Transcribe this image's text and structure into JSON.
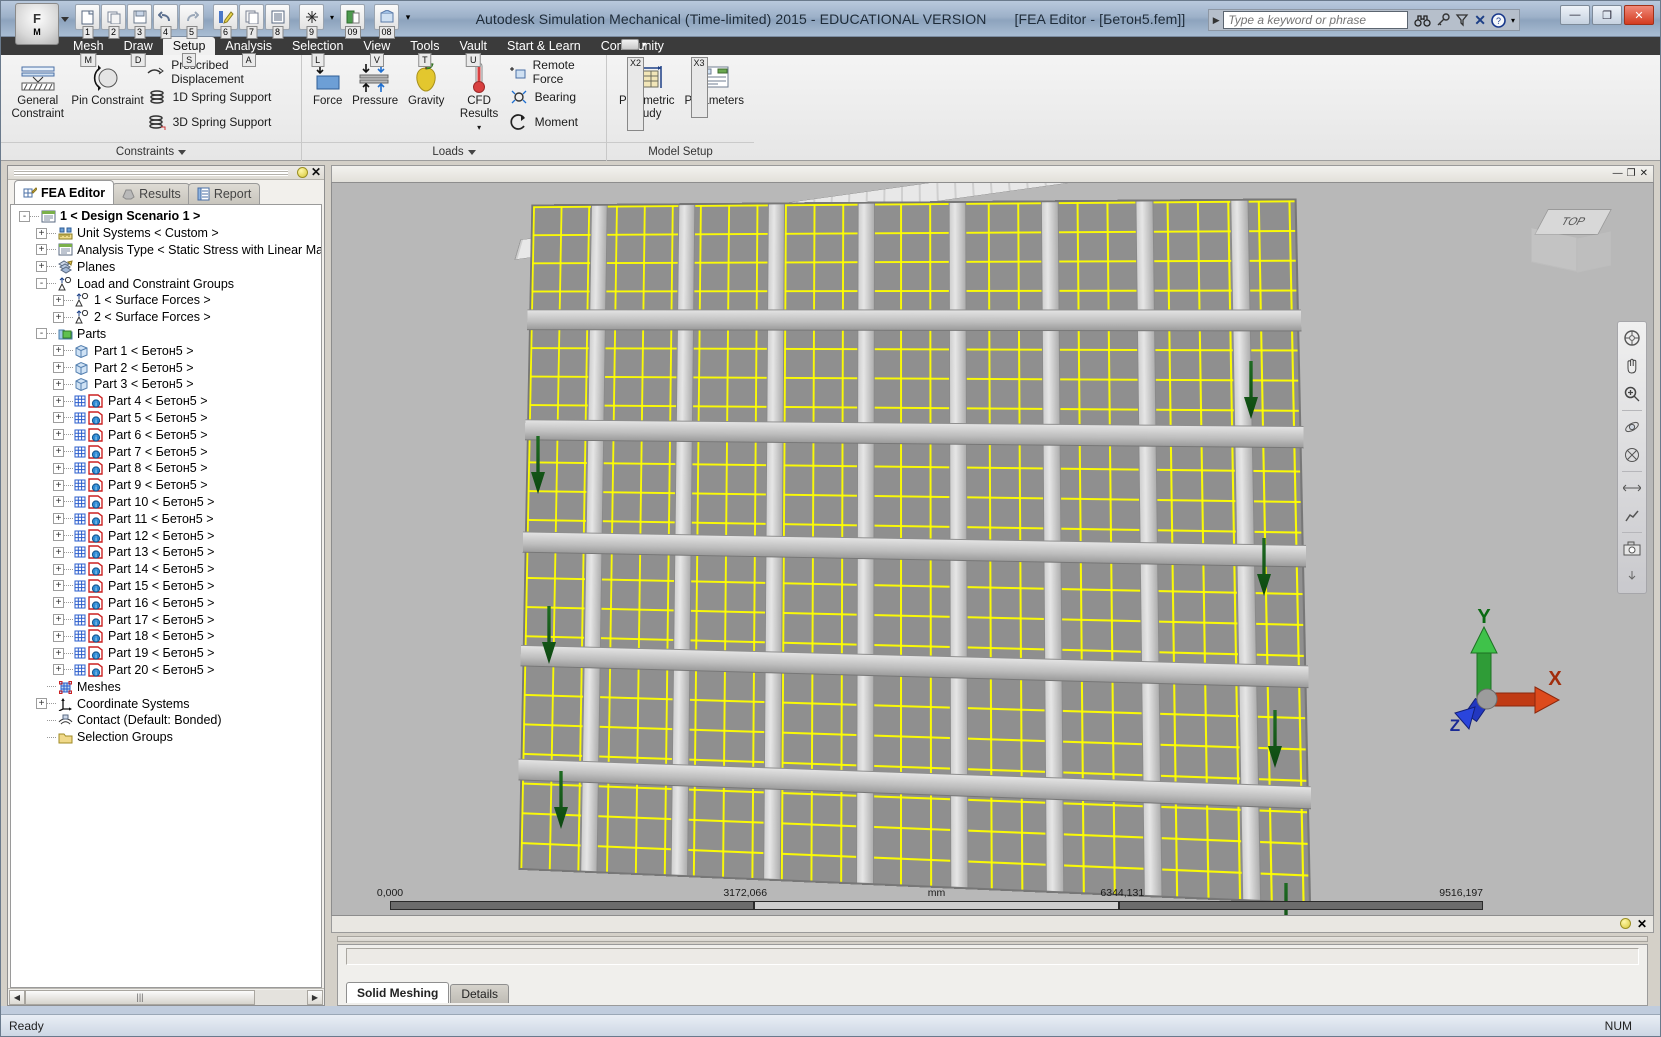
{
  "window": {
    "title": "Autodesk Simulation Mechanical (Time-limited) 2015 - EDUCATIONAL VERSION",
    "document": "[FEA Editor - [Бетон5.fem]]",
    "minimize_label": "—",
    "restore_label": "❐",
    "close_label": "✕",
    "app_button_label": "F",
    "app_button_key": "M"
  },
  "quick_access": {
    "items": [
      {
        "name": "new-document",
        "key": "1"
      },
      {
        "name": "open-document",
        "key": "2"
      },
      {
        "name": "save-document",
        "key": "3"
      },
      {
        "name": "undo",
        "key": "4"
      },
      {
        "name": "redo",
        "key": "5"
      },
      {
        "name": "edit-color",
        "key": "6"
      },
      {
        "name": "copy",
        "key": "7"
      },
      {
        "name": "report",
        "key": "8"
      },
      {
        "name": "mesh-settings",
        "key": "9"
      },
      {
        "name": "results-options",
        "key": "09"
      },
      {
        "name": "model-view",
        "key": "08"
      }
    ]
  },
  "search": {
    "placeholder": "Type a keyword or phrase",
    "icons": [
      "binoculars-icon",
      "key-icon",
      "funnel-icon",
      "exchange-icon",
      "help-icon"
    ]
  },
  "ribbon": {
    "tabs": [
      {
        "label": "Mesh",
        "key": "M",
        "active": false
      },
      {
        "label": "Draw",
        "key": "D",
        "active": false
      },
      {
        "label": "Setup",
        "key": "S",
        "active": true
      },
      {
        "label": "Analysis",
        "key": "A",
        "active": false
      },
      {
        "label": "Selection",
        "key": "L",
        "active": false
      },
      {
        "label": "View",
        "key": "V",
        "active": false
      },
      {
        "label": "Tools",
        "key": "T",
        "active": false
      },
      {
        "label": "Vault",
        "key": "U",
        "active": false
      },
      {
        "label": "Start & Learn",
        "key": "",
        "active": false
      },
      {
        "label": "Community",
        "key": "",
        "active": false
      }
    ],
    "groups": [
      {
        "title": "Constraints",
        "big_buttons": [
          {
            "label": "General Constraint",
            "icon": "general-constraint-icon"
          },
          {
            "label": "Pin Constraint",
            "icon": "pin-constraint-icon"
          }
        ],
        "small_items": [
          {
            "label": "Prescribed Displacement",
            "icon": "prescribed-displacement-icon"
          },
          {
            "label": "1D Spring Support",
            "icon": "spring-1d-icon"
          },
          {
            "label": "3D Spring Support",
            "icon": "spring-3d-icon"
          }
        ]
      },
      {
        "title": "Loads",
        "big_buttons": [
          {
            "label": "Force",
            "icon": "force-icon"
          },
          {
            "label": "Pressure",
            "icon": "pressure-icon"
          },
          {
            "label": "Gravity",
            "icon": "gravity-apple-icon"
          },
          {
            "label": "CFD Results",
            "icon": "cfd-thermometer-icon"
          }
        ],
        "small_items": [
          {
            "label": "Remote Force",
            "icon": "remote-force-icon"
          },
          {
            "label": "Bearing",
            "icon": "bearing-icon"
          },
          {
            "label": "Moment",
            "icon": "moment-icon"
          }
        ]
      },
      {
        "title": "Model Setup",
        "big_buttons": [
          {
            "label": "Parametric Study",
            "icon": "parametric-study-icon",
            "key": "X2"
          },
          {
            "label": "Parameters",
            "icon": "parameters-icon",
            "key": "X3"
          }
        ],
        "small_items": []
      }
    ]
  },
  "tree_panel": {
    "tabs": [
      {
        "label": "FEA Editor",
        "icon": "fea-editor-icon",
        "active": true
      },
      {
        "label": "Results",
        "icon": "results-icon",
        "active": false
      },
      {
        "label": "Report",
        "icon": "report-icon",
        "active": false
      }
    ],
    "items": [
      {
        "label": "1 < Design Scenario 1 >",
        "depth": 0,
        "expander": "-",
        "icon": "scenario-icon",
        "bold": true
      },
      {
        "label": "Unit Systems < Custom >",
        "depth": 1,
        "expander": "+",
        "icon": "unit-systems-icon",
        "bold": false
      },
      {
        "label": "Analysis Type < Static Stress with Linear Mater",
        "depth": 1,
        "expander": "+",
        "icon": "analysis-type-icon",
        "bold": false
      },
      {
        "label": "Planes",
        "depth": 1,
        "expander": "+",
        "icon": "planes-icon",
        "bold": false
      },
      {
        "label": "Load and Constraint Groups",
        "depth": 1,
        "expander": "-",
        "icon": "load-constraint-icon",
        "bold": false
      },
      {
        "label": "1 < Surface Forces >",
        "depth": 2,
        "expander": "+",
        "icon": "surface-forces-icon",
        "bold": false
      },
      {
        "label": "2 < Surface Forces >",
        "depth": 2,
        "expander": "+",
        "icon": "surface-forces-icon",
        "bold": false
      },
      {
        "label": "Parts",
        "depth": 1,
        "expander": "-",
        "icon": "parts-folder-icon",
        "bold": false
      },
      {
        "label": "Part 1 < Бетон5 >",
        "depth": 2,
        "expander": "+",
        "icon": "part-solid-icon",
        "bold": false
      },
      {
        "label": "Part 2 < Бетон5 >",
        "depth": 2,
        "expander": "+",
        "icon": "part-solid-icon",
        "bold": false
      },
      {
        "label": "Part 3 < Бетон5 >",
        "depth": 2,
        "expander": "+",
        "icon": "part-solid-icon",
        "bold": false
      },
      {
        "label": "Part 4 < Бетон5 >",
        "depth": 2,
        "expander": "+",
        "icon": "part-meshed-icon",
        "bold": false
      },
      {
        "label": "Part 5 < Бетон5 >",
        "depth": 2,
        "expander": "+",
        "icon": "part-meshed-icon",
        "bold": false
      },
      {
        "label": "Part 6 < Бетон5 >",
        "depth": 2,
        "expander": "+",
        "icon": "part-meshed-icon",
        "bold": false
      },
      {
        "label": "Part 7 < Бетон5 >",
        "depth": 2,
        "expander": "+",
        "icon": "part-meshed-icon",
        "bold": false
      },
      {
        "label": "Part 8 < Бетон5 >",
        "depth": 2,
        "expander": "+",
        "icon": "part-meshed-icon",
        "bold": false
      },
      {
        "label": "Part 9 < Бетон5 >",
        "depth": 2,
        "expander": "+",
        "icon": "part-meshed-icon",
        "bold": false
      },
      {
        "label": "Part 10 < Бетон5 >",
        "depth": 2,
        "expander": "+",
        "icon": "part-meshed-icon",
        "bold": false
      },
      {
        "label": "Part 11 < Бетон5 >",
        "depth": 2,
        "expander": "+",
        "icon": "part-meshed-icon",
        "bold": false
      },
      {
        "label": "Part 12 < Бетон5 >",
        "depth": 2,
        "expander": "+",
        "icon": "part-meshed-icon",
        "bold": false
      },
      {
        "label": "Part 13 < Бетон5 >",
        "depth": 2,
        "expander": "+",
        "icon": "part-meshed-icon",
        "bold": false
      },
      {
        "label": "Part 14 < Бетон5 >",
        "depth": 2,
        "expander": "+",
        "icon": "part-meshed-icon",
        "bold": false
      },
      {
        "label": "Part 15 < Бетон5 >",
        "depth": 2,
        "expander": "+",
        "icon": "part-meshed-icon",
        "bold": false
      },
      {
        "label": "Part 16 < Бетон5 >",
        "depth": 2,
        "expander": "+",
        "icon": "part-meshed-icon",
        "bold": false
      },
      {
        "label": "Part 17 < Бетон5 >",
        "depth": 2,
        "expander": "+",
        "icon": "part-meshed-icon",
        "bold": false
      },
      {
        "label": "Part 18 < Бетон5 >",
        "depth": 2,
        "expander": "+",
        "icon": "part-meshed-icon",
        "bold": false
      },
      {
        "label": "Part 19 < Бетон5 >",
        "depth": 2,
        "expander": "+",
        "icon": "part-meshed-icon",
        "bold": false
      },
      {
        "label": "Part 20 < Бетон5 >",
        "depth": 2,
        "expander": "+",
        "icon": "part-meshed-icon",
        "bold": false
      },
      {
        "label": "Meshes",
        "depth": 1,
        "expander": "",
        "icon": "meshes-icon",
        "bold": false
      },
      {
        "label": "Coordinate Systems",
        "depth": 1,
        "expander": "+",
        "icon": "coordinate-systems-icon",
        "bold": false
      },
      {
        "label": "Contact (Default: Bonded)",
        "depth": 1,
        "expander": "",
        "icon": "contact-icon",
        "bold": false
      },
      {
        "label": "Selection Groups",
        "depth": 1,
        "expander": "",
        "icon": "selection-groups-icon",
        "bold": false
      }
    ],
    "hscroll_grip": "|||"
  },
  "viewport": {
    "view_cube_label": "TOP",
    "triad": {
      "x": "X",
      "y": "Y",
      "z": "Z"
    },
    "scale_labels": [
      "0,000",
      "3172,066",
      "mm",
      "6344,131",
      "9516,197"
    ],
    "nav_icons": [
      "steering-wheel-icon",
      "pan-hand-icon",
      "zoom-icon",
      "orbit-icon",
      "look-icon",
      "fit-icon",
      "walk-icon",
      "camera-icon"
    ]
  },
  "output": {
    "tabs": [
      {
        "label": "Solid Meshing",
        "active": true
      },
      {
        "label": "Details",
        "active": false
      }
    ],
    "input_value": ""
  },
  "statusbar": {
    "message": "Ready",
    "num_lock": "NUM"
  },
  "colors": {
    "mesh_yellow": "#ffff00",
    "load_arrow_green": "#1a6b1f",
    "axis_x": "#d03a10",
    "axis_y": "#22a02a",
    "axis_z": "#1f3fd0",
    "accent_blue": "#2a5c9a"
  }
}
